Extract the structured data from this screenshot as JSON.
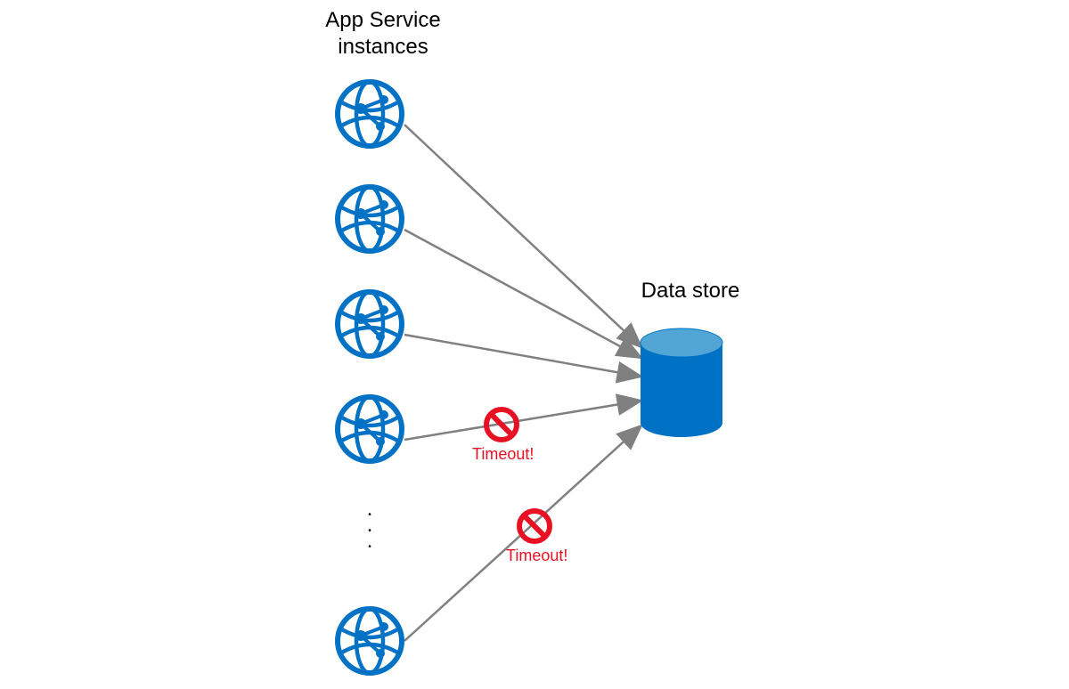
{
  "labels": {
    "app_service_title": "App Service\ninstances",
    "data_store_title": "Data store",
    "timeout1": "Timeout!",
    "timeout2": "Timeout!"
  },
  "colors": {
    "azure_blue": "#0072c6",
    "arrow_gray": "#808080",
    "error_red": "#e81123"
  },
  "icons": {
    "app_service": "app-service-icon",
    "datastore": "database-icon",
    "forbidden": "no-entry-icon"
  }
}
